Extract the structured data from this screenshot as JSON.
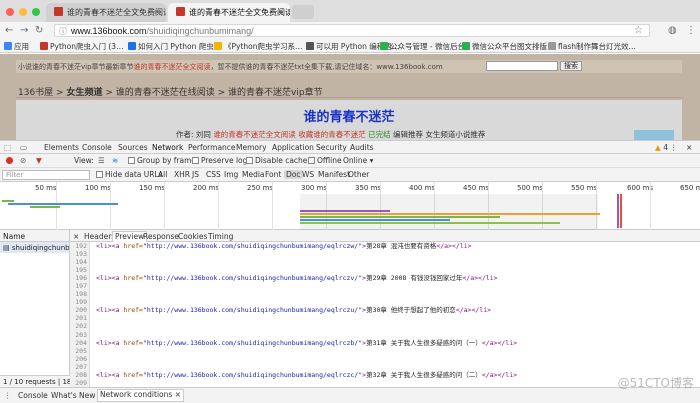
{
  "browser": {
    "tabs": [
      {
        "title": "谁的青春不迷茫全文免费阅读-迷",
        "active": false
      },
      {
        "title": "谁的青春不迷茫全文免费阅读-迷",
        "active": true
      }
    ],
    "url_host": "www.136book.com",
    "url_path": "/shuidiqingchunbumimang/",
    "bookmarks": [
      {
        "label": "应用",
        "color": "#4285f4"
      },
      {
        "label": "Python爬虫入门 (3…",
        "color": "#c0392b"
      },
      {
        "label": "如何入门 Python 爬虫…",
        "color": "#1a73e8"
      },
      {
        "label": "《Python爬虫学习系…",
        "color": "#f4b400"
      },
      {
        "label": "可以用 Python 编程语…",
        "color": "#555555"
      },
      {
        "label": "公众号管理 - 微信后台",
        "color": "#2bb24c"
      },
      {
        "label": "微信公众平台图文排版…",
        "color": "#2bb24c"
      },
      {
        "label": "flash制作舞台灯光效…",
        "color": "#999999"
      }
    ]
  },
  "page": {
    "notice_prefix": "小说谁的青春不迷茫vip章节最新章节",
    "notice_red": "谁的青春不迷茫全文阅读",
    "notice_suffix": "，暂不提供谁的青春不迷茫txt全集下载,请记住域名：www.136book.com",
    "search_btn": "搜索",
    "crumb_site": "136书屋",
    "crumb_cat": "女生频道",
    "crumb_read": "谁的青春不迷茫在线阅读",
    "crumb_vip": "谁的青春不迷茫vip章节",
    "book_title": "谁的青春不迷茫",
    "meta_author": "作者: 刘同",
    "meta_red": "谁的青春不迷茫全文阅读 收藏谁的青春不迷茫",
    "meta_green": "已完结",
    "meta_rest": "编辑推荐 女生频道小说推荐"
  },
  "devtools": {
    "tabs": [
      "Elements",
      "Console",
      "Sources",
      "Network",
      "Performance",
      "Memory",
      "Application",
      "Security",
      "Audits"
    ],
    "active_tab": "Network",
    "warnings": "4",
    "toolbar": {
      "view": "View:",
      "group_by_frame": "Group by frame",
      "preserve_log": "Preserve log",
      "disable_cache": "Disable cache",
      "offline": "Offline",
      "throttle": "Online"
    },
    "filter_placeholder": "Filter",
    "hide_data_urls": "Hide data URLs",
    "filter_types": [
      "All",
      "XHR",
      "JS",
      "CSS",
      "Img",
      "Media",
      "Font",
      "Doc",
      "WS",
      "Manifest",
      "Other"
    ],
    "active_filter": "Doc",
    "timeline_ticks": [
      "50 ms",
      "100 ms",
      "150 ms",
      "200 ms",
      "250 ms",
      "300 ms",
      "350 ms",
      "400 ms",
      "450 ms",
      "500 ms",
      "550 ms",
      "600 ms",
      "650 m"
    ],
    "name_header": "Name",
    "request_name": "shuidiqingchunbumim…",
    "status": "1 / 10 requests | 18…",
    "detail_tabs": [
      "Headers",
      "Preview",
      "Response",
      "Cookies",
      "Timing"
    ],
    "active_detail_tab": "Preview",
    "line_numbers": [
      "192",
      "193",
      "194",
      "195",
      "196",
      "197",
      "198",
      "199",
      "200",
      "201",
      "202",
      "203",
      "204",
      "205",
      "206",
      "207",
      "208",
      "209"
    ],
    "code_lines": [
      {
        "href": "http://www.136book.com/shuidiqingchunbumimang/eqlrczw/",
        "text": "第28章 混沌也要有资格"
      },
      {
        "href": "",
        "text": ""
      },
      {
        "href": "",
        "text": ""
      },
      {
        "href": "",
        "text": ""
      },
      {
        "href": "http://www.136book.com/shuidiqingchunbumimang/eqlrczv/",
        "text": "第29章 2008 有钱没钱回家过年"
      },
      {
        "href": "",
        "text": ""
      },
      {
        "href": "",
        "text": ""
      },
      {
        "href": "",
        "text": ""
      },
      {
        "href": "http://www.136book.com/shuidiqingchunbumimang/eqlrczu/",
        "text": "第30章 他终于想起了他的初恋"
      },
      {
        "href": "",
        "text": ""
      },
      {
        "href": "",
        "text": ""
      },
      {
        "href": "",
        "text": ""
      },
      {
        "href": "http://www.136book.com/shuidiqingchunbumimang/eqlrczb/",
        "text": "第31章 关于我人生很多疑惑的问（一）"
      },
      {
        "href": "",
        "text": ""
      },
      {
        "href": "",
        "text": ""
      },
      {
        "href": "",
        "text": ""
      },
      {
        "href": "http://www.136book.com/shuidiqingchunbumimang/eqlrczc/",
        "text": "第32章 关于我人生很多疑惑的问（二）"
      },
      {
        "href": "",
        "text": ""
      }
    ],
    "drawer_tabs": [
      "Console",
      "What's New",
      "Network conditions"
    ],
    "active_drawer_tab": "Network conditions"
  },
  "watermark": "@51CTO博客"
}
